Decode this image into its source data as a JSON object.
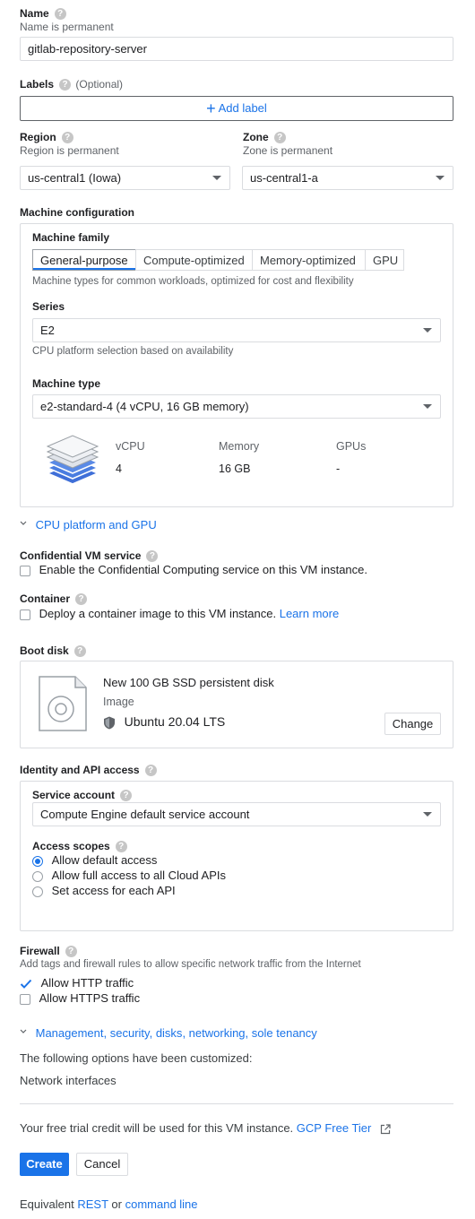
{
  "name": {
    "label": "Name",
    "sublabel": "Name is permanent",
    "value": "gitlab-repository-server"
  },
  "labels": {
    "label": "Labels",
    "optional": "(Optional)",
    "add_label": "Add label"
  },
  "region": {
    "label": "Region",
    "sublabel": "Region is permanent",
    "value": "us-central1 (Iowa)"
  },
  "zone": {
    "label": "Zone",
    "sublabel": "Zone is permanent",
    "value": "us-central1-a"
  },
  "machine_config": {
    "label": "Machine configuration",
    "family_label": "Machine family",
    "tabs": [
      "General-purpose",
      "Compute-optimized",
      "Memory-optimized",
      "GPU"
    ],
    "family_desc": "Machine types for common workloads, optimized for cost and flexibility",
    "series_label": "Series",
    "series_value": "E2",
    "series_desc": "CPU platform selection based on availability",
    "type_label": "Machine type",
    "type_value": "e2-standard-4 (4 vCPU, 16 GB memory)",
    "specs": {
      "vcpu_label": "vCPU",
      "vcpu_value": "4",
      "memory_label": "Memory",
      "memory_value": "16 GB",
      "gpus_label": "GPUs",
      "gpus_value": "-"
    },
    "cpu_platform_link": "CPU platform and GPU"
  },
  "confidential": {
    "label": "Confidential VM service",
    "checkbox_label": "Enable the Confidential Computing service on this VM instance."
  },
  "container": {
    "label": "Container",
    "checkbox_label": "Deploy a container image to this VM instance.",
    "learn_more": "Learn more"
  },
  "boot_disk": {
    "label": "Boot disk",
    "title": "New 100 GB SSD persistent disk",
    "image_label": "Image",
    "image_value": "Ubuntu 20.04 LTS",
    "change_button": "Change"
  },
  "identity": {
    "label": "Identity and API access",
    "service_account_label": "Service account",
    "service_account_value": "Compute Engine default service account",
    "scopes_label": "Access scopes",
    "scopes": [
      "Allow default access",
      "Allow full access to all Cloud APIs",
      "Set access for each API"
    ]
  },
  "firewall": {
    "label": "Firewall",
    "desc": "Add tags and firewall rules to allow specific network traffic from the Internet",
    "http": "Allow HTTP traffic",
    "https": "Allow HTTPS traffic"
  },
  "management": {
    "links": [
      "Management",
      "security",
      "disks",
      "networking",
      "sole tenancy"
    ],
    "customized_note": "The following options have been customized:",
    "network_interfaces": "Network interfaces"
  },
  "footer": {
    "trial_note": "Your free trial credit will be used for this VM instance.",
    "free_tier_link": "GCP Free Tier",
    "create_button": "Create",
    "cancel_button": "Cancel",
    "equivalent_prefix": "Equivalent",
    "rest_link": "REST",
    "or": "or",
    "command_line_link": "command line"
  },
  "colors": {
    "accent": "#1a73e8",
    "border": "#dadce0",
    "text": "#202124",
    "muted": "#5f6368"
  }
}
